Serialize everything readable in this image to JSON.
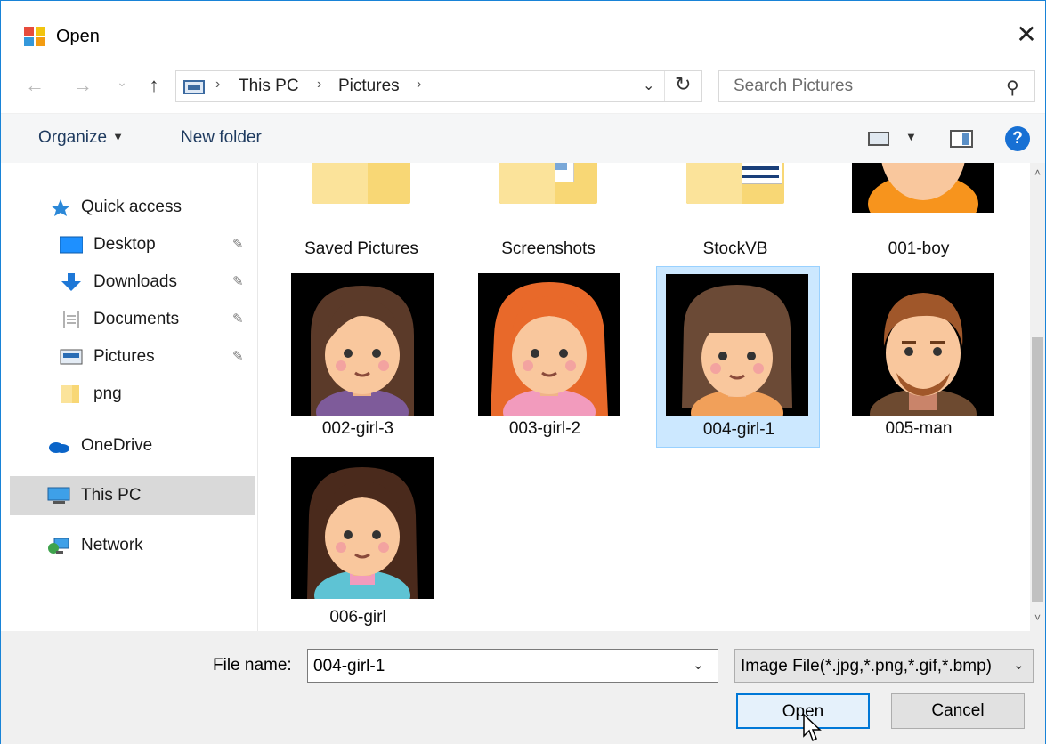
{
  "window": {
    "title": "Open",
    "close_glyph": "✕"
  },
  "nav": {
    "back_glyph": "←",
    "forward_glyph": "→",
    "recent_glyph": "⌄",
    "up_glyph": "↑"
  },
  "address": {
    "segments": [
      "This PC",
      "Pictures"
    ],
    "chevron": "›",
    "dropdown_glyph": "⌄",
    "refresh_glyph": "↻"
  },
  "search": {
    "placeholder": "Search Pictures",
    "icon_glyph": "⚲"
  },
  "commands": {
    "organize": "Organize",
    "organize_caret": "▼",
    "new_folder": "New folder",
    "view_caret": "▼",
    "help": "?"
  },
  "sidebar": {
    "pin_glyph": "📌",
    "items": [
      {
        "label": "Quick access",
        "icon": "quick-access-star-icon"
      },
      {
        "label": "Desktop",
        "icon": "desktop-icon",
        "pinned": true
      },
      {
        "label": "Downloads",
        "icon": "downloads-icon",
        "pinned": true
      },
      {
        "label": "Documents",
        "icon": "documents-icon",
        "pinned": true
      },
      {
        "label": "Pictures",
        "icon": "pictures-icon",
        "pinned": true
      },
      {
        "label": "png",
        "icon": "folder-icon"
      },
      {
        "label": "OneDrive",
        "icon": "onedrive-icon"
      },
      {
        "label": "This PC",
        "icon": "this-pc-icon",
        "selected": true
      },
      {
        "label": "Network",
        "icon": "network-icon"
      }
    ]
  },
  "files": [
    {
      "name": "Saved Pictures",
      "kind": "folder"
    },
    {
      "name": "Screenshots",
      "kind": "folder"
    },
    {
      "name": "StockVB",
      "kind": "folder"
    },
    {
      "name": "001-boy",
      "kind": "image",
      "hair": "#000000",
      "shirt": "#f7941d"
    },
    {
      "name": "002-girl-3",
      "kind": "image",
      "hair": "#5b3a29",
      "shirt": "#7e5b9a"
    },
    {
      "name": "003-girl-2",
      "kind": "image",
      "hair": "#e8692a",
      "shirt": "#f29bbd"
    },
    {
      "name": "004-girl-1",
      "kind": "image",
      "hair": "#6b4a36",
      "shirt": "#f1a05a",
      "selected": true
    },
    {
      "name": "005-man",
      "kind": "image",
      "hair": "#a0572a",
      "shirt": "#6d4a30"
    },
    {
      "name": "006-girl",
      "kind": "image",
      "hair": "#4a2a1c",
      "shirt": "#5ec3d4"
    }
  ],
  "scroll": {
    "up_glyph": "˄",
    "down_glyph": "˅"
  },
  "footer": {
    "filename_label": "File name:",
    "filename_value": "004-girl-1",
    "filename_drop": "⌄",
    "filetype_value": "Image File(*.jpg,*.png,*.gif,*.bmp)",
    "filetype_drop": "⌄",
    "open_label": "Open",
    "cancel_label": "Cancel"
  },
  "colors": {
    "accent": "#0078d7",
    "selection": "#cce8ff",
    "folder": "#f8d775",
    "skin": "#f9c79d"
  }
}
